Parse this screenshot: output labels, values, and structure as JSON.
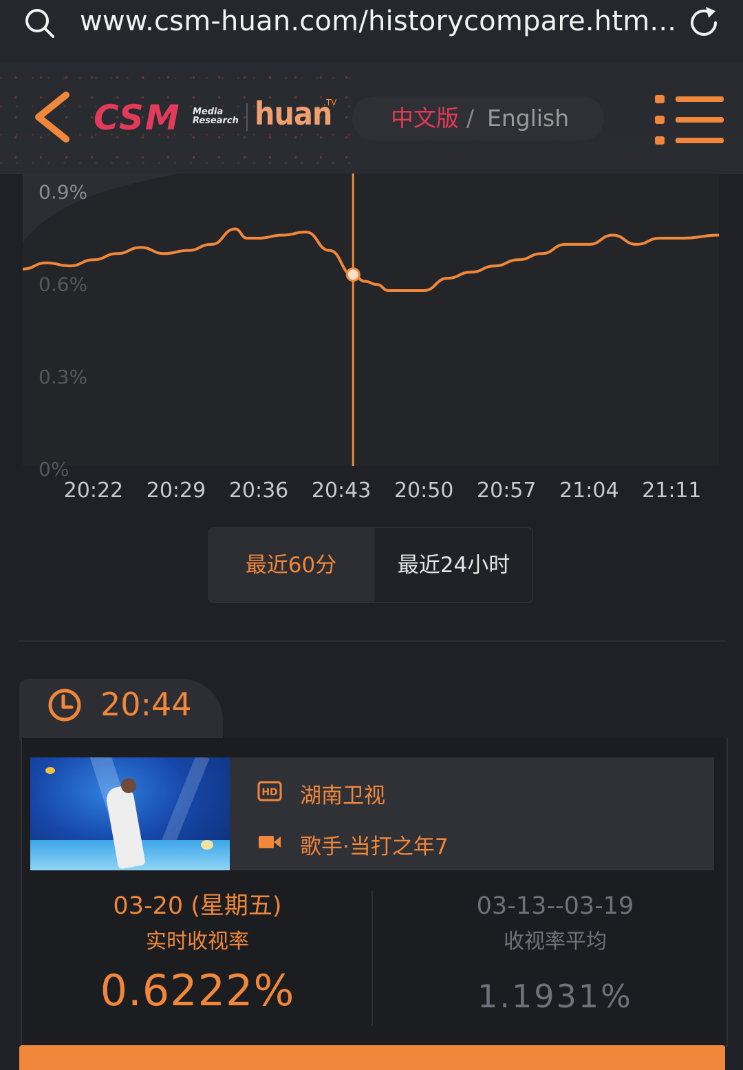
{
  "browser": {
    "url": "www.csm-huan.com/historycompare.htm..."
  },
  "header": {
    "logo_csm": "CSM",
    "logo_csm_sub_1": "Media",
    "logo_csm_sub_2": "Research",
    "logo_huan": "huan",
    "logo_huan_tv": ".TV",
    "lang_zh": "中文版",
    "lang_sep": "/",
    "lang_en": "English"
  },
  "chart_data": {
    "type": "line",
    "y_ticks": [
      "0.9%",
      "0.6%",
      "0.3%",
      "0%"
    ],
    "y_tick_values": [
      0.9,
      0.6,
      0.3,
      0
    ],
    "ylim": [
      0,
      0.95
    ],
    "x_ticks": [
      "20:22",
      "20:29",
      "20:36",
      "20:43",
      "20:50",
      "20:57",
      "21:04",
      "21:11"
    ],
    "x_start_min": 1216,
    "x_end_min": 1275,
    "x_tick_min": [
      1222,
      1229,
      1236,
      1243,
      1250,
      1257,
      1264,
      1271
    ],
    "series": [
      {
        "color": "#f0873a",
        "x_min": [
          1216,
          1218,
          1220,
          1222,
          1224,
          1226,
          1228,
          1230,
          1232,
          1234,
          1235,
          1236,
          1238,
          1240,
          1242,
          1244,
          1245,
          1246,
          1247,
          1248,
          1250,
          1252,
          1254,
          1256,
          1258,
          1260,
          1262,
          1264,
          1266,
          1268,
          1270,
          1272,
          1275
        ],
        "values": [
          0.64,
          0.66,
          0.65,
          0.67,
          0.69,
          0.71,
          0.69,
          0.7,
          0.72,
          0.77,
          0.74,
          0.74,
          0.75,
          0.76,
          0.7,
          0.62,
          0.6,
          0.59,
          0.57,
          0.57,
          0.57,
          0.61,
          0.63,
          0.65,
          0.67,
          0.69,
          0.72,
          0.72,
          0.75,
          0.72,
          0.74,
          0.74,
          0.75
        ]
      }
    ],
    "cursor_x_min": 1244,
    "cursor_value": 0.622
  },
  "range": {
    "opt1": "最近60分",
    "opt2": "最近24小时"
  },
  "time_tab": {
    "time": "20:44"
  },
  "program": {
    "channel": "湖南卫视",
    "show": "歌手·当打之年7",
    "channel_icon": "HD"
  },
  "stats": {
    "left_date": "03-20 (星期五)",
    "left_label": "实时收视率",
    "left_value": "0.6222%",
    "right_date": "03-13--03-19",
    "right_label": "收视率平均",
    "right_value": "1.1931%"
  },
  "colors": {
    "accent": "#f0873a",
    "brand_red": "#e33a55",
    "background": "#1f2126"
  }
}
